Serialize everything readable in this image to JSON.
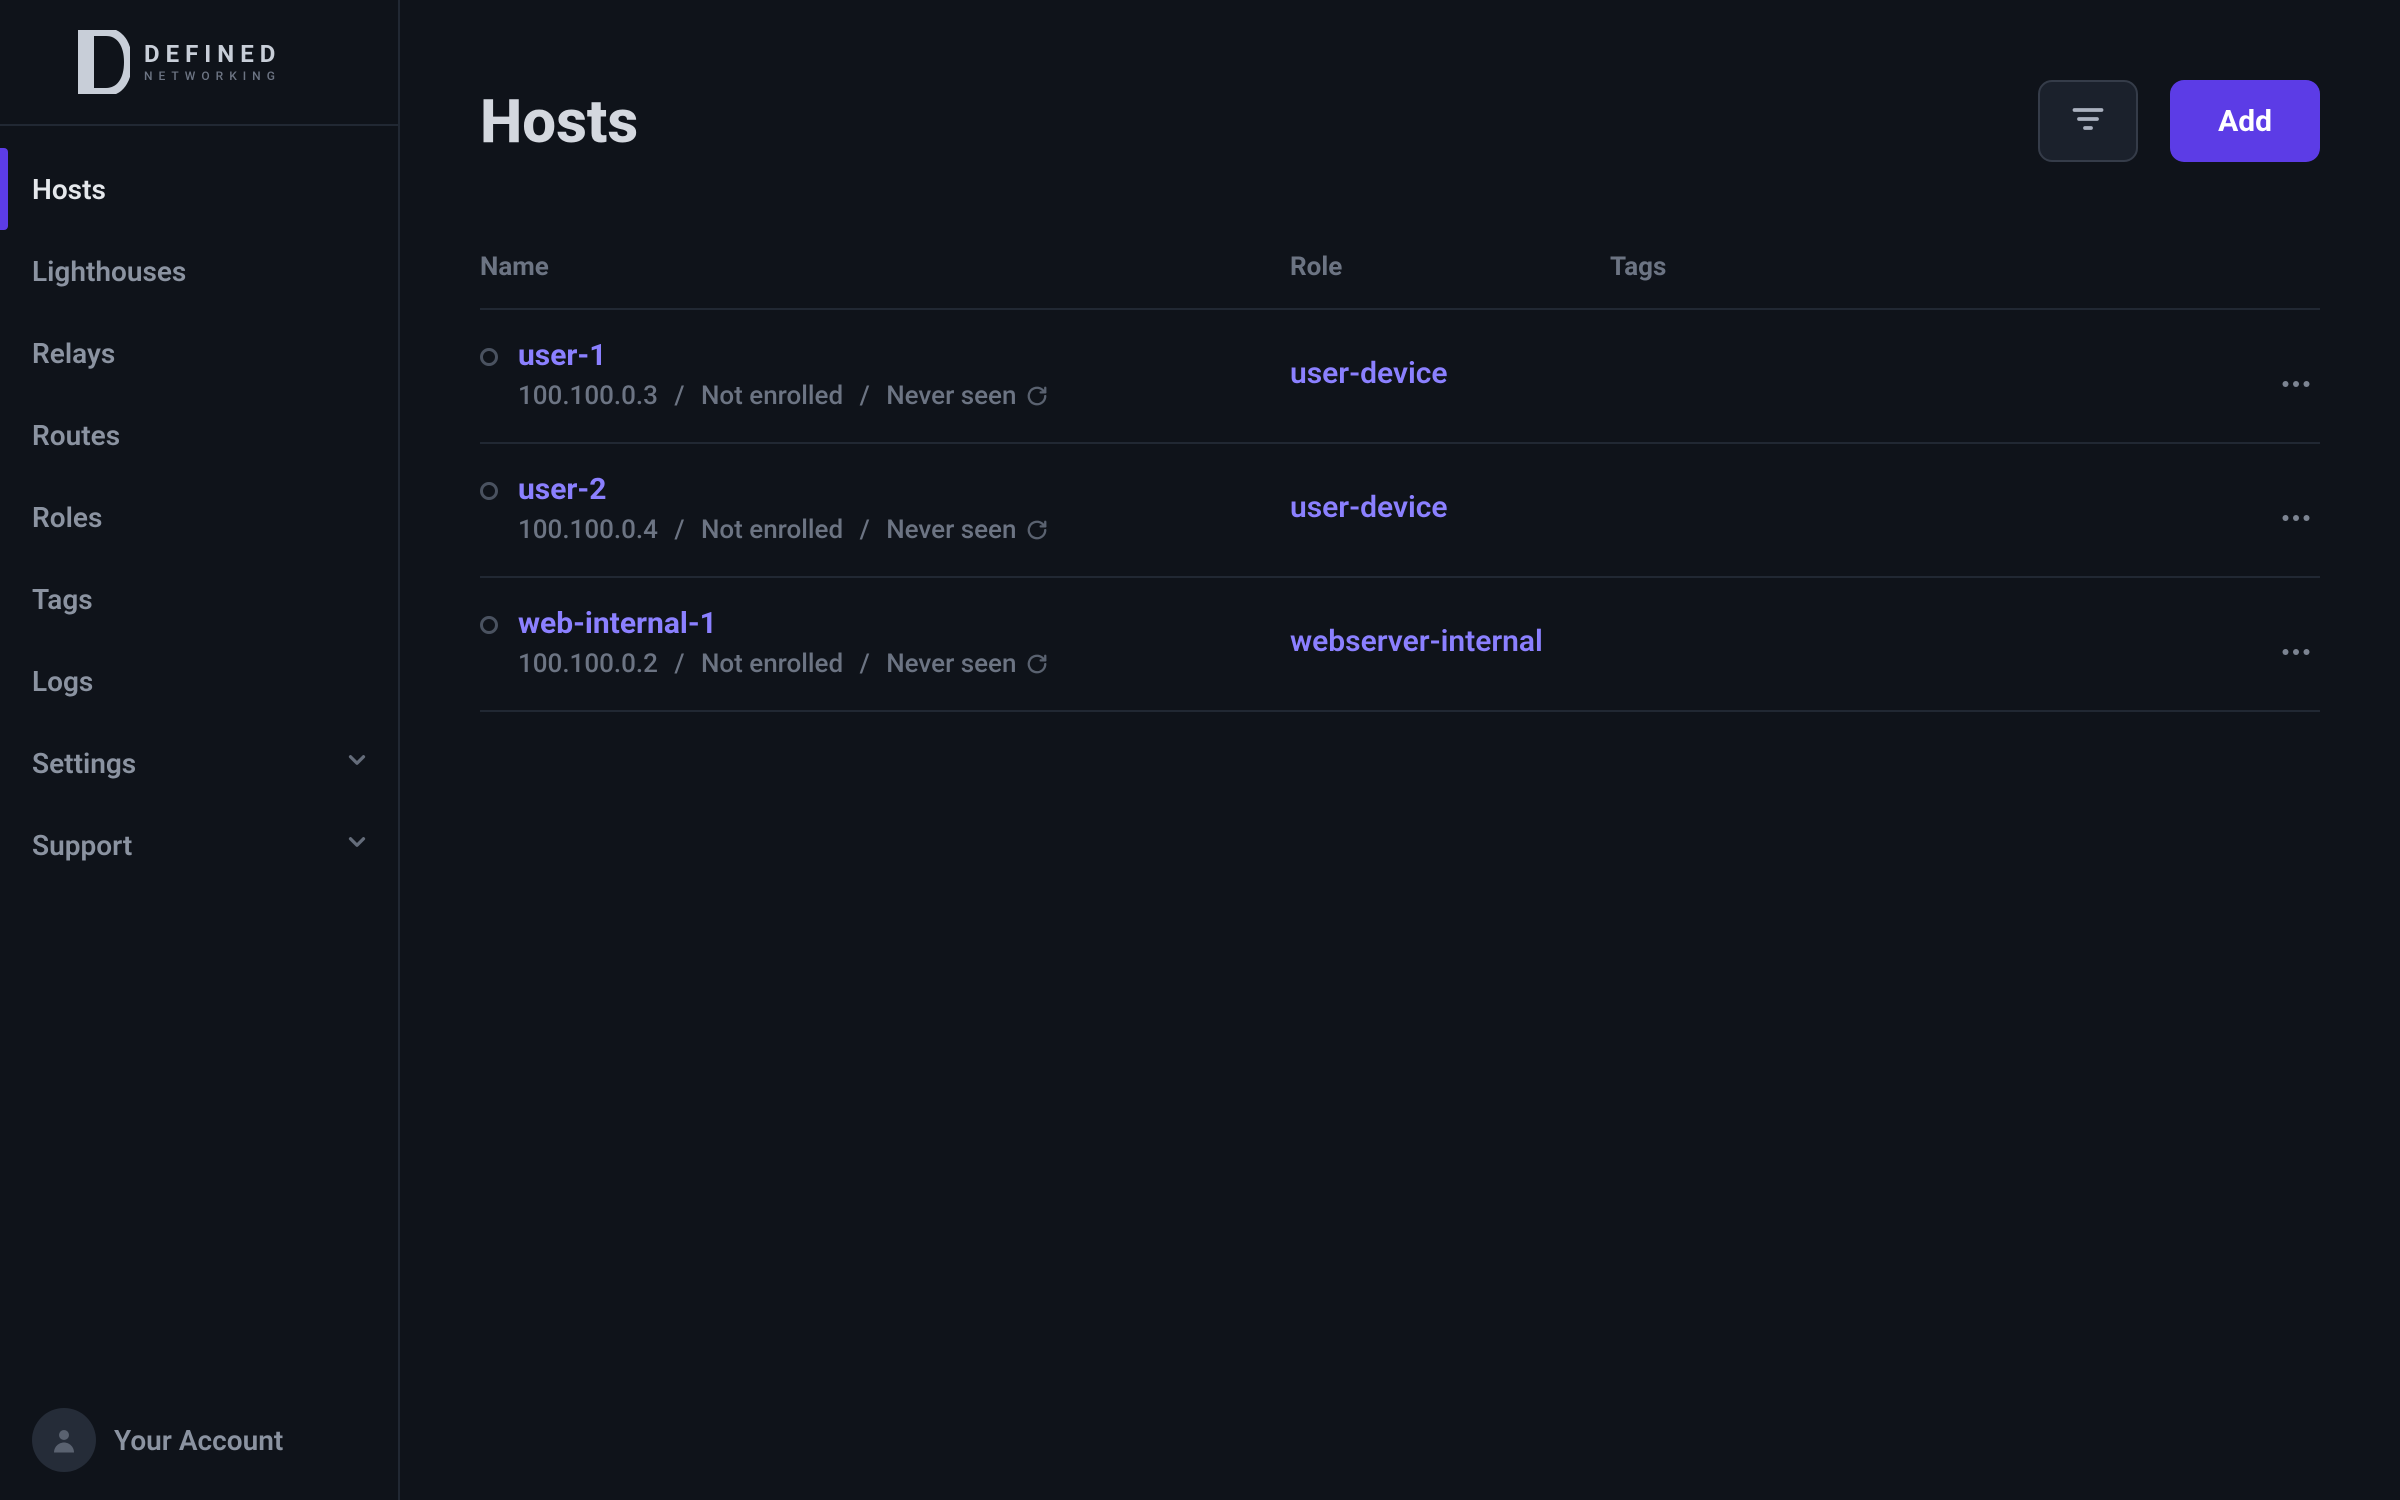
{
  "brand": {
    "line1": "DEFINED",
    "line2": "NETWORKING"
  },
  "sidebar": {
    "items": [
      {
        "label": "Hosts",
        "active": true,
        "expandable": false
      },
      {
        "label": "Lighthouses",
        "active": false,
        "expandable": false
      },
      {
        "label": "Relays",
        "active": false,
        "expandable": false
      },
      {
        "label": "Routes",
        "active": false,
        "expandable": false
      },
      {
        "label": "Roles",
        "active": false,
        "expandable": false
      },
      {
        "label": "Tags",
        "active": false,
        "expandable": false
      },
      {
        "label": "Logs",
        "active": false,
        "expandable": false
      },
      {
        "label": "Settings",
        "active": false,
        "expandable": true
      },
      {
        "label": "Support",
        "active": false,
        "expandable": true
      }
    ],
    "account_label": "Your Account"
  },
  "header": {
    "title": "Hosts",
    "add_label": "Add"
  },
  "table": {
    "columns": {
      "name": "Name",
      "role": "Role",
      "tags": "Tags"
    },
    "rows": [
      {
        "name": "user-1",
        "ip": "100.100.0.3",
        "enroll": "Not enrolled",
        "seen": "Never seen",
        "role": "user-device",
        "tags": ""
      },
      {
        "name": "user-2",
        "ip": "100.100.0.4",
        "enroll": "Not enrolled",
        "seen": "Never seen",
        "role": "user-device",
        "tags": ""
      },
      {
        "name": "web-internal-1",
        "ip": "100.100.0.2",
        "enroll": "Not enrolled",
        "seen": "Never seen",
        "role": "webserver-internal",
        "tags": ""
      }
    ]
  }
}
